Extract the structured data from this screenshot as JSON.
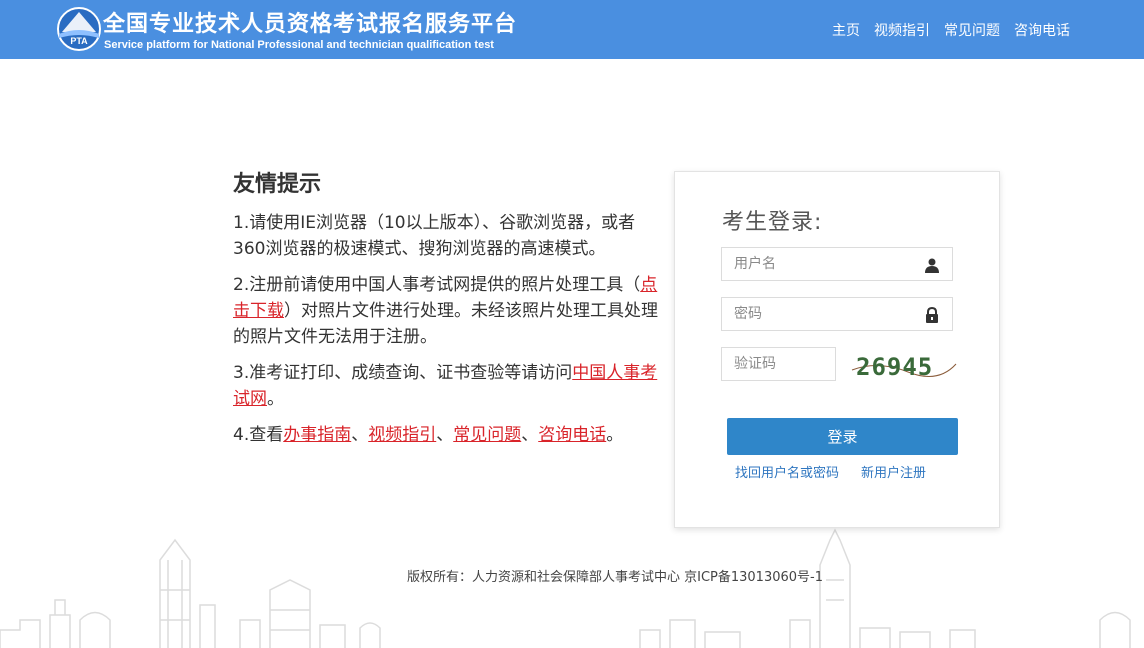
{
  "header": {
    "title": "全国专业技术人员资格考试报名服务平台",
    "subtitle": "Service platform for National Professional and technician qualification test",
    "logo_text": "PTA",
    "nav": [
      "主页",
      "视频指引",
      "常见问题",
      "咨询电话"
    ],
    "bg_color": "#4a8fe0"
  },
  "tips": {
    "title": "友情提示",
    "tip1": "1.请使用IE浏览器（10以上版本）、谷歌浏览器，或者360浏览器的极速模式、搜狗浏览器的高速模式。",
    "tip2_a": "2.注册前请使用中国人事考试网提供的照片处理工具（",
    "tip2_link": "点击下载",
    "tip2_b": "）对照片文件进行处理。未经该照片处理工具处理的照片文件无法用于注册。",
    "tip3_a": "3.准考证打印、成绩查询、证书查验等请访问",
    "tip3_link": "中国人事考试网",
    "tip3_b": "。",
    "tip4_a": "4.查看",
    "tip4_links": [
      "办事指南",
      "视频指引",
      "常见问题",
      "咨询电话"
    ],
    "tip4_sep": "、",
    "tip4_end": "。",
    "link_color": "#d9242a"
  },
  "login": {
    "title": "考生登录:",
    "username_placeholder": "用户名",
    "password_placeholder": "密码",
    "captcha_placeholder": "验证码",
    "captcha_text": "26945",
    "submit_label": "登录",
    "forgot_label": "找回用户名或密码",
    "register_label": "新用户注册",
    "button_color": "#2f86c9"
  },
  "footer": {
    "copyright": "版权所有：人力资源和社会保障部人事考试中心 京ICP备13013060号-1"
  },
  "icons": {
    "logo": "pta-logo-icon",
    "user": "user-icon",
    "lock": "lock-icon"
  }
}
